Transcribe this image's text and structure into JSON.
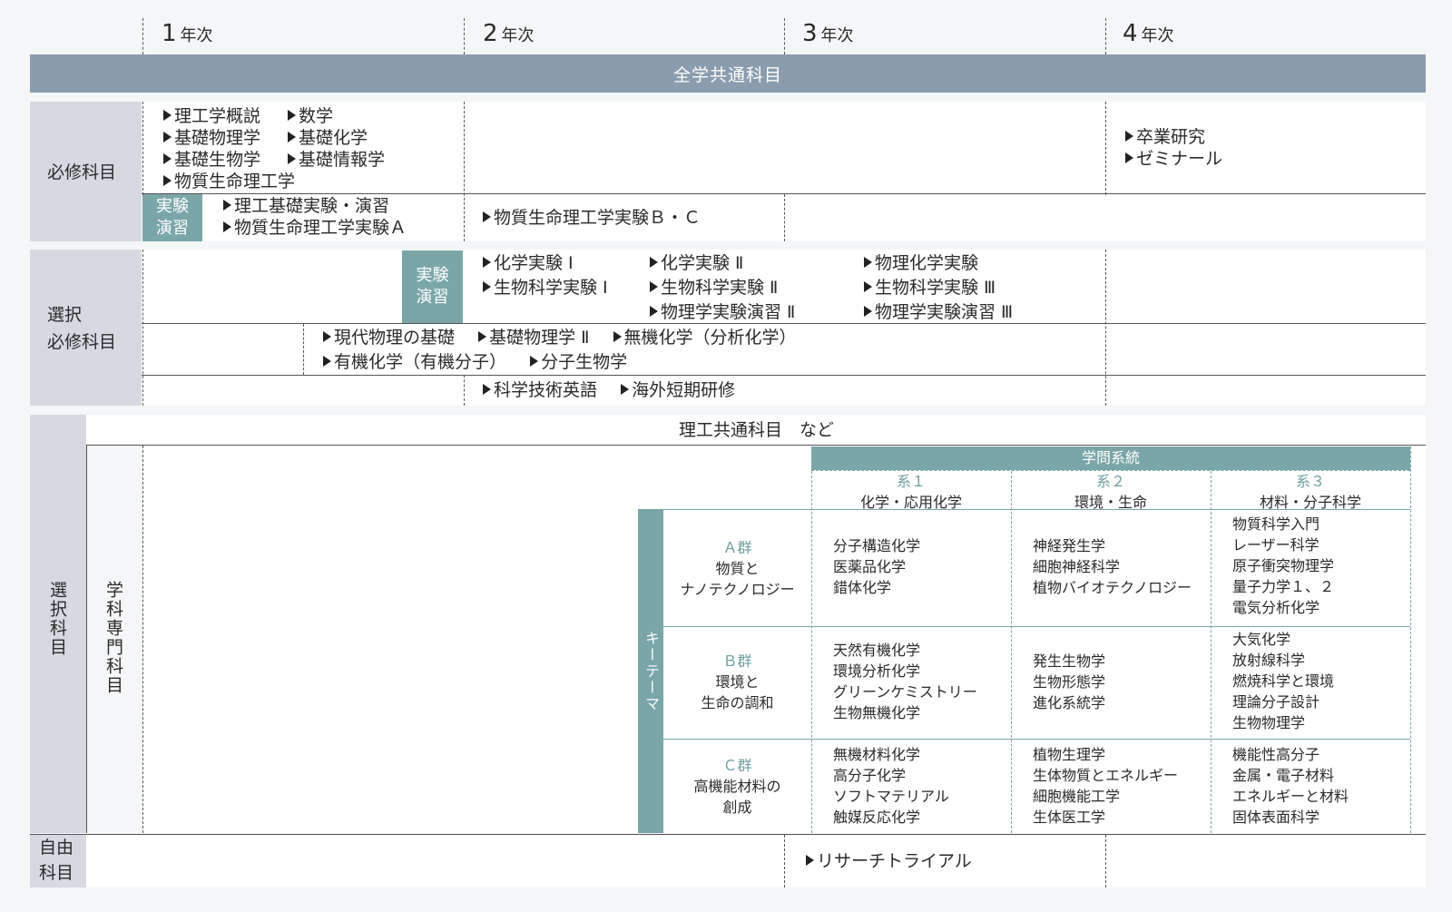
{
  "years": [
    {
      "num": "1",
      "suffix": "年次"
    },
    {
      "num": "2",
      "suffix": "年次"
    },
    {
      "num": "3",
      "suffix": "年次"
    },
    {
      "num": "4",
      "suffix": "年次"
    }
  ],
  "common_banner": "全学共通科目",
  "required": {
    "label": "必修科目",
    "items_left": [
      "理工学概説",
      "基礎物理学",
      "基礎生物学",
      "物質生命理工学"
    ],
    "items_right": [
      "数学",
      "基礎化学",
      "基礎情報学"
    ],
    "items_y4": [
      "卒業研究",
      "ゼミナール"
    ],
    "lab_label": [
      "実験",
      "演習"
    ],
    "lab_y1": [
      "理工基礎実験・演習",
      "物質生命理工学実験Ａ"
    ],
    "lab_y2": [
      "物質生命理工学実験Ｂ・Ｃ"
    ]
  },
  "elective_required": {
    "label": [
      "選択",
      "必修科目"
    ],
    "lab_label": [
      "実験",
      "演習"
    ],
    "lab_col1": [
      "化学実験 Ⅰ",
      "生物科学実験 Ⅰ"
    ],
    "lab_col2": [
      "化学実験 Ⅱ",
      "生物科学実験 Ⅱ",
      "物理学実験演習 Ⅱ"
    ],
    "lab_col3": [
      "物理化学実験",
      "生物科学実験 Ⅲ",
      "物理学実験演習 Ⅲ"
    ],
    "row2_line1": [
      "現代物理の基礎",
      "基礎物理学 Ⅱ",
      "無機化学（分析化学）"
    ],
    "row2_line2": [
      "有機化学（有機分子）",
      "分子生物学"
    ],
    "row3": [
      "科学技術英語",
      "海外短期研修"
    ]
  },
  "elective": {
    "label": "選択科目",
    "sub_label": "学科専門科目",
    "common_sci": "理工共通科目　など",
    "system_header": "学問系統",
    "keytheme": "キーテーマ",
    "systems": [
      {
        "code": "系１",
        "name": "化学・応用化学"
      },
      {
        "code": "系２",
        "name": "環境・生命"
      },
      {
        "code": "系３",
        "name": "材料・分子科学"
      }
    ],
    "groups": [
      {
        "code": "Ａ群",
        "name": [
          "物質と",
          "ナノテクノロジー"
        ],
        "s1": [
          "分子構造化学",
          "医薬品化学",
          "錯体化学"
        ],
        "s2": [
          "神経発生学",
          "細胞神経科学",
          "植物バイオテクノロジー"
        ],
        "s3": [
          "物質科学入門",
          "レーザー科学",
          "原子衝突物理学",
          "量子力学１、２",
          "電気分析化学"
        ]
      },
      {
        "code": "Ｂ群",
        "name": [
          "環境と",
          "生命の調和"
        ],
        "s1": [
          "天然有機化学",
          "環境分析化学",
          "グリーンケミストリー",
          "生物無機化学"
        ],
        "s2": [
          "発生生物学",
          "生物形態学",
          "進化系統学"
        ],
        "s3": [
          "大気化学",
          "放射線科学",
          "燃焼科学と環境",
          "理論分子設計",
          "生物物理学"
        ]
      },
      {
        "code": "Ｃ群",
        "name": [
          "高機能材料の",
          "創成"
        ],
        "s1": [
          "無機材料化学",
          "高分子化学",
          "ソフトマテリアル",
          "触媒反応化学"
        ],
        "s2": [
          "植物生理学",
          "生体物質とエネルギー",
          "細胞機能工学",
          "生体医工学"
        ],
        "s3": [
          "機能性高分子",
          "金属・電子材料",
          "エネルギーと材料",
          "固体表面科学"
        ]
      }
    ]
  },
  "free": {
    "label": [
      "自由",
      "科目"
    ],
    "item": "リサーチトライアル"
  }
}
